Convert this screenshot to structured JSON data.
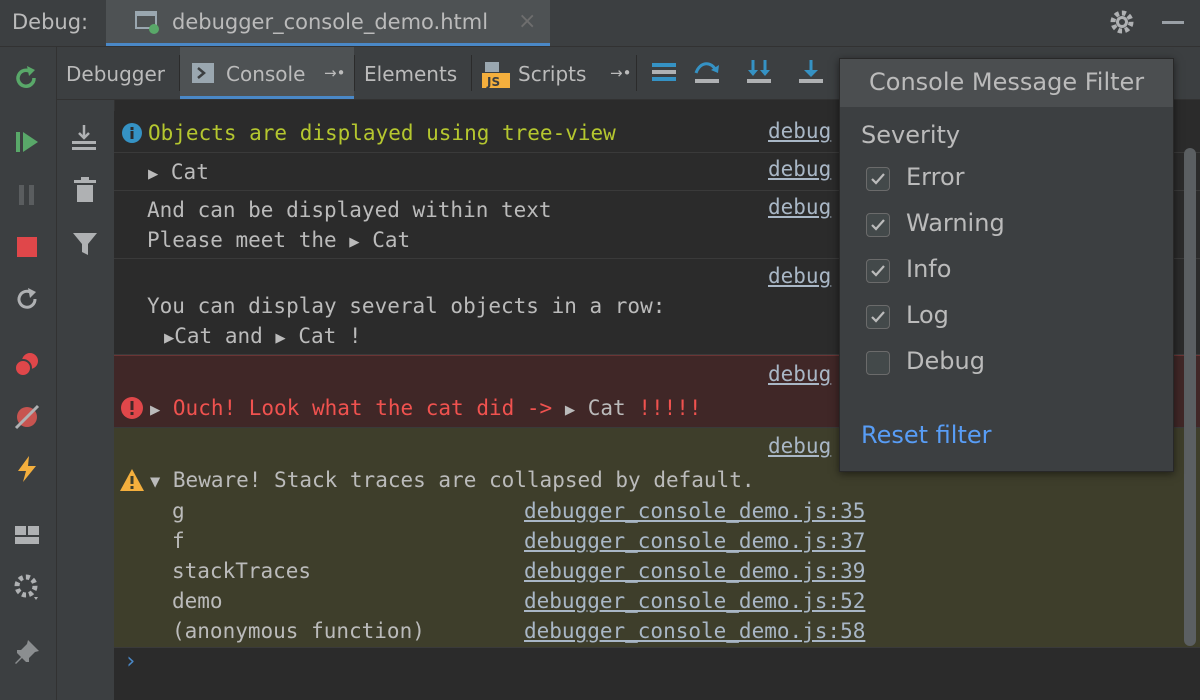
{
  "header": {
    "debug_label": "Debug:",
    "file_tab_label": "debugger_console_demo.html",
    "close_symbol": "×"
  },
  "toolbar": {
    "tabs": {
      "debugger": "Debugger",
      "console": "Console",
      "elements": "Elements",
      "scripts": "Scripts"
    },
    "scripts_badge": "JS",
    "pin_symbol": "→•"
  },
  "console": {
    "rows": [
      {
        "text": "Objects are displayed using tree-view",
        "source": "debug"
      },
      {
        "text": "Cat",
        "source": "debug"
      },
      {
        "line1": "And can be displayed within text",
        "line2_prefix": "Please meet the ",
        "line2_obj": "Cat",
        "source": "debug"
      },
      {
        "line1": "You can display several objects in a row:",
        "obj1": "Cat",
        "mid": " and ",
        "obj2": "Cat",
        "suffix": " !",
        "source": "debug"
      },
      {
        "text": "Ouch! Look what the cat did -> ",
        "obj": "Cat",
        "suffix": " !!!!!",
        "source": "debug"
      },
      {
        "text": "Beware! Stack traces are collapsed by default.",
        "source": "debug"
      }
    ],
    "stack": [
      {
        "name": "g",
        "link": "debugger_console_demo.js:35"
      },
      {
        "name": "f",
        "link": "debugger_console_demo.js:37"
      },
      {
        "name": "stackTraces",
        "link": "debugger_console_demo.js:39"
      },
      {
        "name": "demo",
        "link": "debugger_console_demo.js:52"
      },
      {
        "name": "(anonymous function)",
        "link": "debugger_console_demo.js:58"
      }
    ],
    "prompt": "›"
  },
  "filter": {
    "title": "Console Message Filter",
    "severity_label": "Severity",
    "options": [
      {
        "label": "Error",
        "checked": true
      },
      {
        "label": "Warning",
        "checked": true
      },
      {
        "label": "Info",
        "checked": true
      },
      {
        "label": "Log",
        "checked": true
      },
      {
        "label": "Debug",
        "checked": false
      }
    ],
    "reset_label": "Reset filter"
  },
  "colors": {
    "info_text": "#b5c72f",
    "error_text": "#f0524f",
    "accent": "#4a88c7",
    "link": "#589df6"
  },
  "icons": {
    "left_toolbar": [
      "rerun-icon",
      "resume-icon",
      "pause-icon",
      "stop-icon",
      "restart-icon",
      "breakpoints-icon",
      "mute-breakpoints-icon",
      "lightning-icon",
      "layout-icon",
      "settings-icon",
      "pin-icon"
    ],
    "console_strip": [
      "scroll-to-end-icon",
      "clear-icon",
      "filter-icon"
    ]
  }
}
